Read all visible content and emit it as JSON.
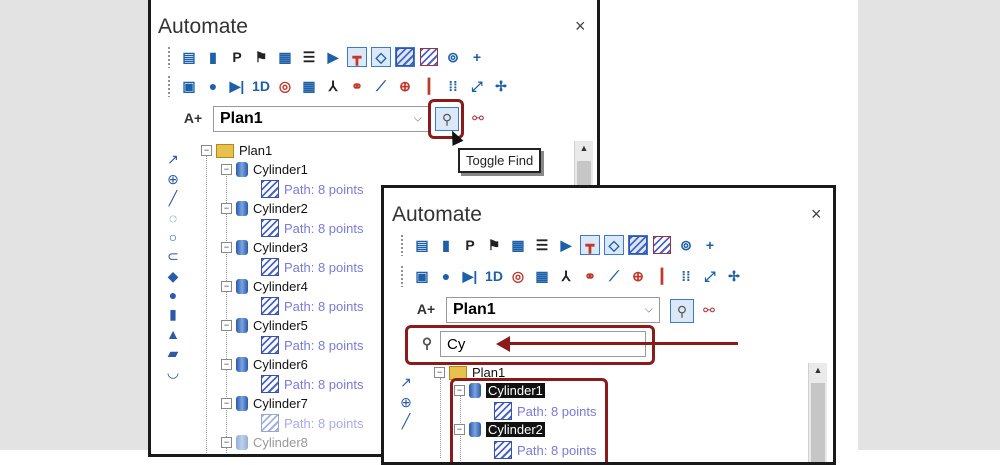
{
  "panel1": {
    "title": "Automate",
    "close": "×",
    "plan_value": "Plan1",
    "tooltip": "Toggle Find",
    "toolbar_row1": [
      "P"
    ],
    "toolbar_row2": [
      "1D"
    ],
    "tree": {
      "root": "Plan1",
      "items": [
        {
          "name": "Cylinder1",
          "path": "Path: 8 points"
        },
        {
          "name": "Cylinder2",
          "path": "Path: 8 points"
        },
        {
          "name": "Cylinder3",
          "path": "Path: 8 points"
        },
        {
          "name": "Cylinder4",
          "path": "Path: 8 points"
        },
        {
          "name": "Cylinder5",
          "path": "Path: 8 points"
        },
        {
          "name": "Cylinder6",
          "path": "Path: 8 points"
        },
        {
          "name": "Cylinder7",
          "path": "Path: 8 points"
        },
        {
          "name": "Cylinder8",
          "path": ""
        }
      ]
    }
  },
  "panel2": {
    "title": "Automate",
    "close": "×",
    "plan_value": "Plan1",
    "search_value": "Cy",
    "tree": {
      "root": "Plan1",
      "items": [
        {
          "name": "Cylinder1",
          "path": "Path: 8 points"
        },
        {
          "name": "Cylinder2",
          "path": "Path: 8 points"
        }
      ]
    }
  },
  "colors": {
    "highlight_border": "#8b1a1a",
    "accent": "#3b7ad0"
  }
}
